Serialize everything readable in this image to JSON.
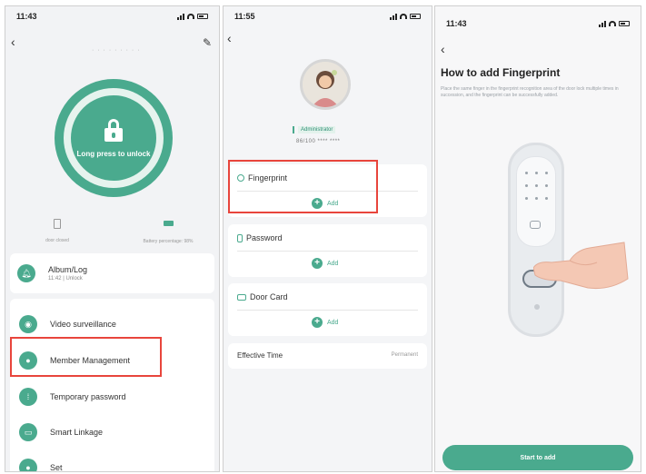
{
  "screen1": {
    "time": "11:43",
    "unlock_label": "Long press to unlock",
    "door_status": "door closed",
    "battery_status": "Battery percentage: 98%",
    "album": {
      "title": "Album/Log",
      "subtitle": "11:42 | Unlock"
    },
    "menu": [
      {
        "label": "Video surveillance",
        "icon": "video-icon"
      },
      {
        "label": "Member Management",
        "icon": "member-icon"
      },
      {
        "label": "Temporary password",
        "icon": "keypad-icon"
      },
      {
        "label": "Smart Linkage",
        "icon": "toggle-icon"
      },
      {
        "label": "Set",
        "icon": "gear-icon"
      }
    ],
    "accent": "#4aaa8e",
    "highlight": "#e8453c"
  },
  "screen2": {
    "time": "11:55",
    "role": "Administrator",
    "user_id": "86/100 **** ****",
    "sections": [
      {
        "label": "Fingerprint",
        "add": "Add",
        "icon": "fingerprint-icon"
      },
      {
        "label": "Password",
        "add": "Add",
        "icon": "phone-icon"
      },
      {
        "label": "Door Card",
        "add": "Add",
        "icon": "card-icon"
      }
    ],
    "effective_time": {
      "label": "Effective Time",
      "value": "Permanent"
    }
  },
  "screen3": {
    "time": "11:43",
    "title": "How to add Fingerprint",
    "description": "Place the same finger in the fingerprint recognition area of the door lock multiple times in succession, and the fingerprint can be successfully added.",
    "start_button": "Start to add"
  }
}
